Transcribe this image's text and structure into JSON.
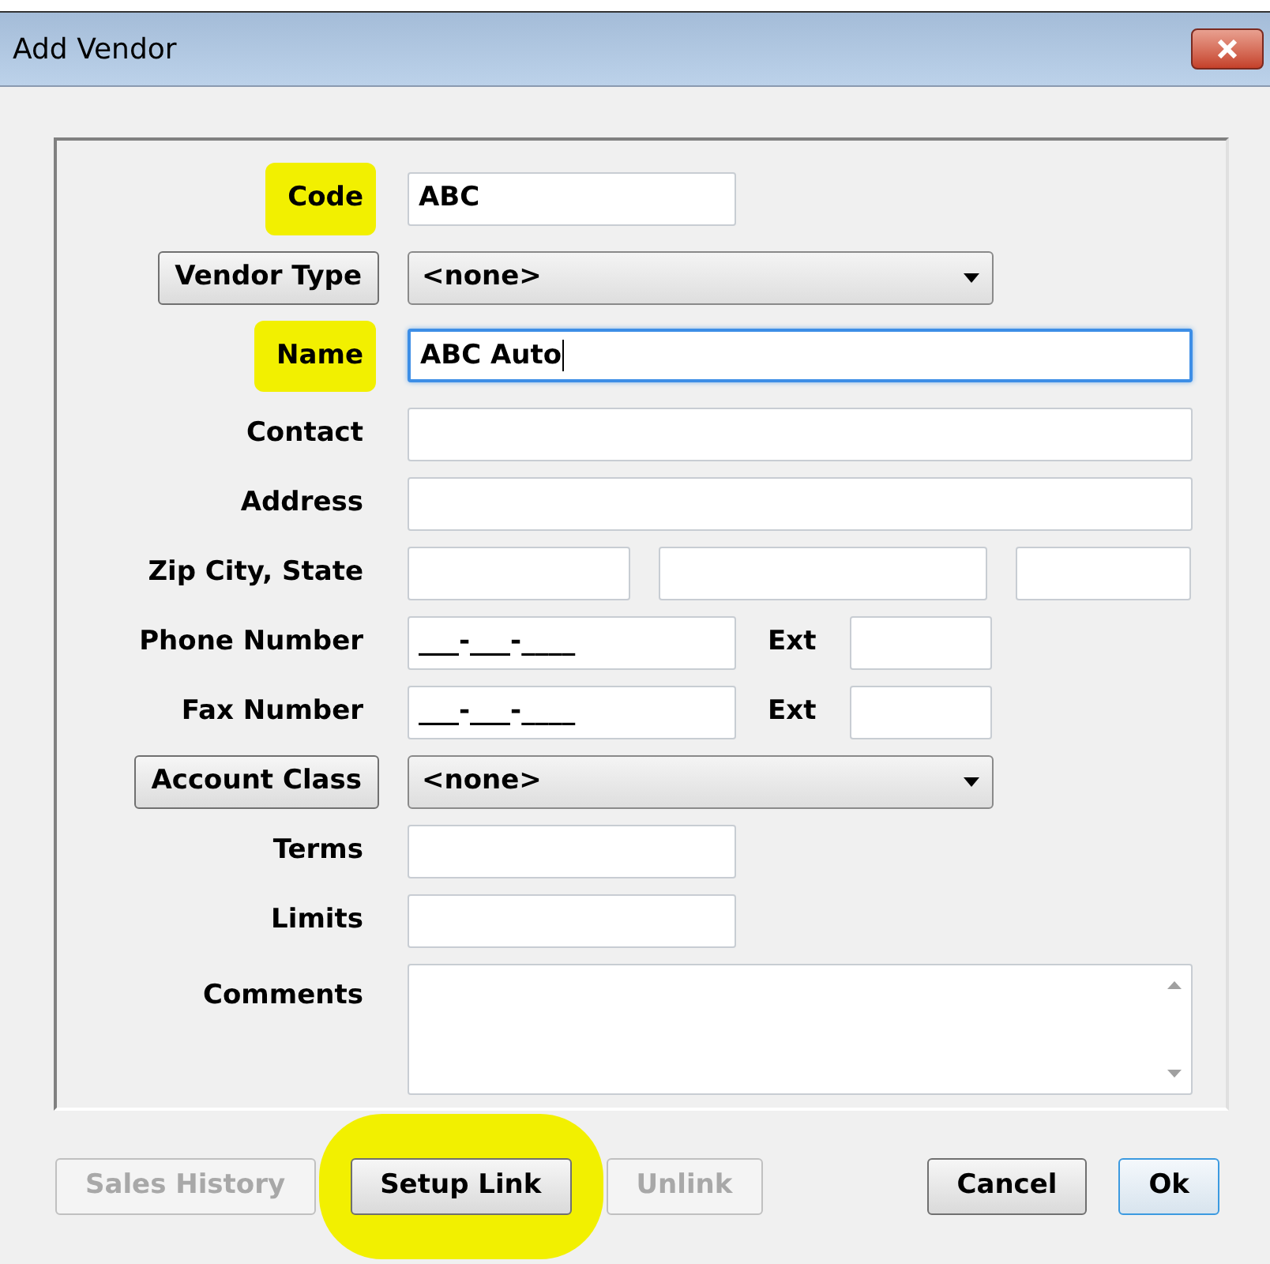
{
  "window": {
    "title": "Add Vendor"
  },
  "rows": [
    {
      "kind": "short",
      "label": "Code",
      "highlighted": true,
      "value": "ABC",
      "focused": false
    },
    {
      "kind": "picker",
      "label": "Vendor Type",
      "value": "<none>"
    },
    {
      "kind": "long",
      "label": "Name",
      "highlighted": true,
      "value": "ABC Auto",
      "focused": true
    },
    {
      "kind": "long",
      "label": "Contact",
      "highlighted": false,
      "value": "",
      "focused": false
    },
    {
      "kind": "long",
      "label": "Address",
      "highlighted": false,
      "value": "",
      "focused": false
    },
    {
      "kind": "address",
      "label": "Zip City, State"
    },
    {
      "kind": "phone",
      "label": "Phone Number",
      "value": "___-___-____",
      "ext_label": "Ext"
    },
    {
      "kind": "phone",
      "label": "Fax Number",
      "value": "___-___-____",
      "ext_label": "Ext"
    },
    {
      "kind": "picker",
      "label": "Account Class",
      "value": "<none>"
    },
    {
      "kind": "short",
      "label": "Terms",
      "highlighted": false,
      "value": "",
      "focused": false
    },
    {
      "kind": "short",
      "label": "Limits",
      "highlighted": false,
      "value": "",
      "focused": false
    },
    {
      "kind": "memo",
      "label": "Comments"
    }
  ],
  "left_buttons": [
    {
      "label": "Sales History",
      "disabled": true,
      "highlighted": false
    },
    {
      "label": "Setup Link",
      "disabled": false,
      "highlighted": true
    },
    {
      "label": "Unlink",
      "disabled": true,
      "highlighted": false
    }
  ],
  "right_buttons": [
    {
      "label": "Cancel",
      "default": false
    },
    {
      "label": "Ok",
      "default": true
    }
  ]
}
